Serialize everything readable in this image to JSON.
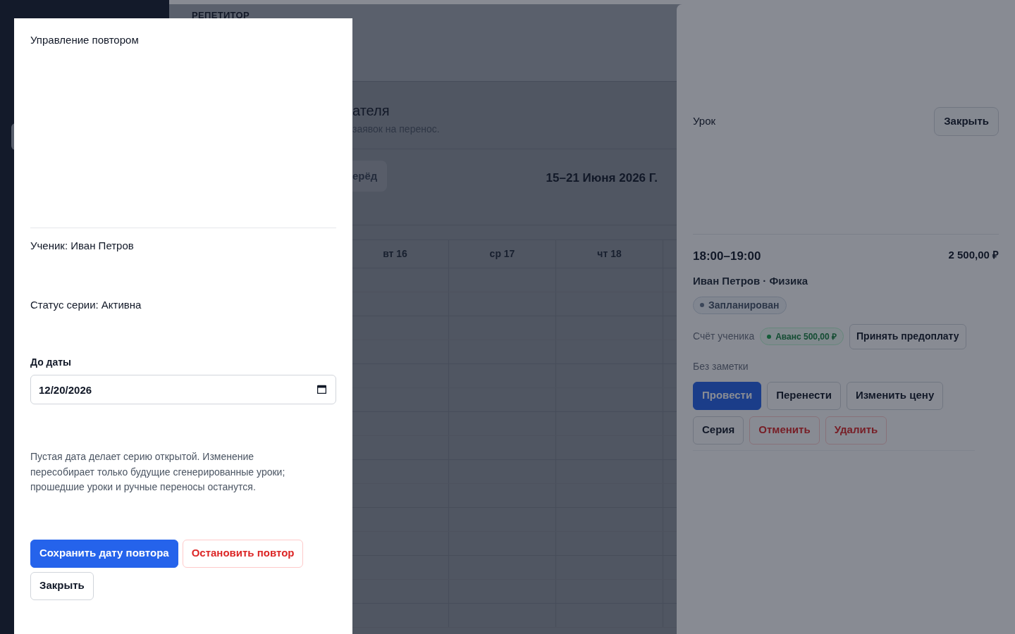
{
  "page": {
    "eyebrow": "РЕПЕТИТОР",
    "heading": "ателя",
    "subtitle": "заявок на перенос.",
    "nav_button": "ерёд",
    "week_range": "15–21 Июня 2026 Г.",
    "day_columns": [
      "вт 16",
      "ср 17",
      "чт 18"
    ]
  },
  "series_dialog": {
    "title": "Управление повтором",
    "student": "Ученик: Иван Петров",
    "status": "Статус серии: Активна",
    "date_label": "До даты",
    "date_value": "12/20/2026",
    "help": "Пустая дата делает серию открытой. Изменение пересобирает только будущие сгенерированные уроки; прошедшие уроки и ручные переносы останутся.",
    "buttons": [
      {
        "label": "Сохранить дату повтора",
        "kind": "primary"
      },
      {
        "label": "Остановить повтор",
        "kind": "danger"
      },
      {
        "label": "Закрыть",
        "kind": "default"
      }
    ]
  },
  "lesson_panel": {
    "title": "Урок",
    "close_button": "Закрыть",
    "time": "18:00–19:00",
    "price": "2 500,00 ₽",
    "student_subject": "Иван Петров · Физика",
    "status_badge": {
      "label": "Запланирован"
    },
    "account_label": "Счёт ученика",
    "balance_badge": {
      "label": "Аванс 500,00 ₽"
    },
    "prepay_button": "Принять предоплату",
    "note": "Без заметки",
    "actions": [
      {
        "label": "Провести",
        "kind": "primary"
      },
      {
        "label": "Перенести",
        "kind": "default"
      },
      {
        "label": "Изменить цену",
        "kind": "default"
      },
      {
        "label": "Серия",
        "kind": "default"
      },
      {
        "label": "Отменить",
        "kind": "danger"
      },
      {
        "label": "Удалить",
        "kind": "danger"
      }
    ]
  }
}
